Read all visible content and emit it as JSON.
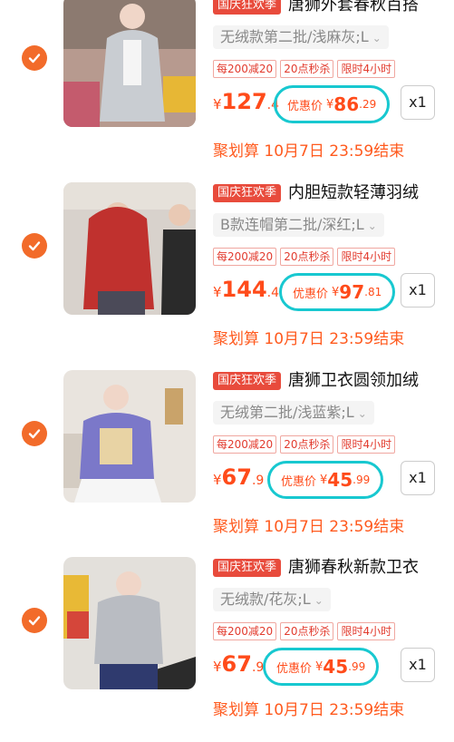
{
  "accent": "#f26b2a",
  "highlight": "#18c8d0",
  "items": [
    {
      "badge": "国庆狂欢季",
      "title": "唐狮外套春秋百搭",
      "variant": "无绒款第二批/浅麻灰;L",
      "tags": [
        "每200减20",
        "20点秒杀",
        "限时4小时"
      ],
      "price_int": "127",
      "price_dec": ".4",
      "promo_label": "优惠价",
      "promo_int": "86",
      "promo_dec": ".29",
      "qty": "x1",
      "deal": "聚划算 10月7日 23:59结束",
      "thumb_color": "#c9cdd2"
    },
    {
      "badge": "国庆狂欢季",
      "title": "内胆短款轻薄羽绒",
      "variant": "B款连帽第二批/深红;L",
      "tags": [
        "每200减20",
        "20点秒杀",
        "限时4小时"
      ],
      "price_int": "144",
      "price_dec": ".4",
      "promo_label": "优惠价",
      "promo_int": "97",
      "promo_dec": ".81",
      "qty": "x1",
      "deal": "聚划算 10月7日 23:59结束",
      "thumb_color": "#c0312e"
    },
    {
      "badge": "国庆狂欢季",
      "title": "唐狮卫衣圆领加绒",
      "variant": "无绒第二批/浅蓝紫;L",
      "tags": [
        "每200减20",
        "20点秒杀",
        "限时4小时"
      ],
      "price_int": "67",
      "price_dec": ".9",
      "promo_label": "优惠价",
      "promo_int": "45",
      "promo_dec": ".99",
      "qty": "x1",
      "deal": "聚划算 10月7日 23:59结束",
      "thumb_color": "#7b78c9"
    },
    {
      "badge": "国庆狂欢季",
      "title": "唐狮春秋新款卫衣",
      "variant": "无绒款/花灰;L",
      "tags": [
        "每200减20",
        "20点秒杀",
        "限时4小时"
      ],
      "price_int": "67",
      "price_dec": ".9",
      "promo_label": "优惠价",
      "promo_int": "45",
      "promo_dec": ".99",
      "qty": "x1",
      "deal": "聚划算 10月7日 23:59结束",
      "thumb_color": "#b9bcc2"
    }
  ]
}
